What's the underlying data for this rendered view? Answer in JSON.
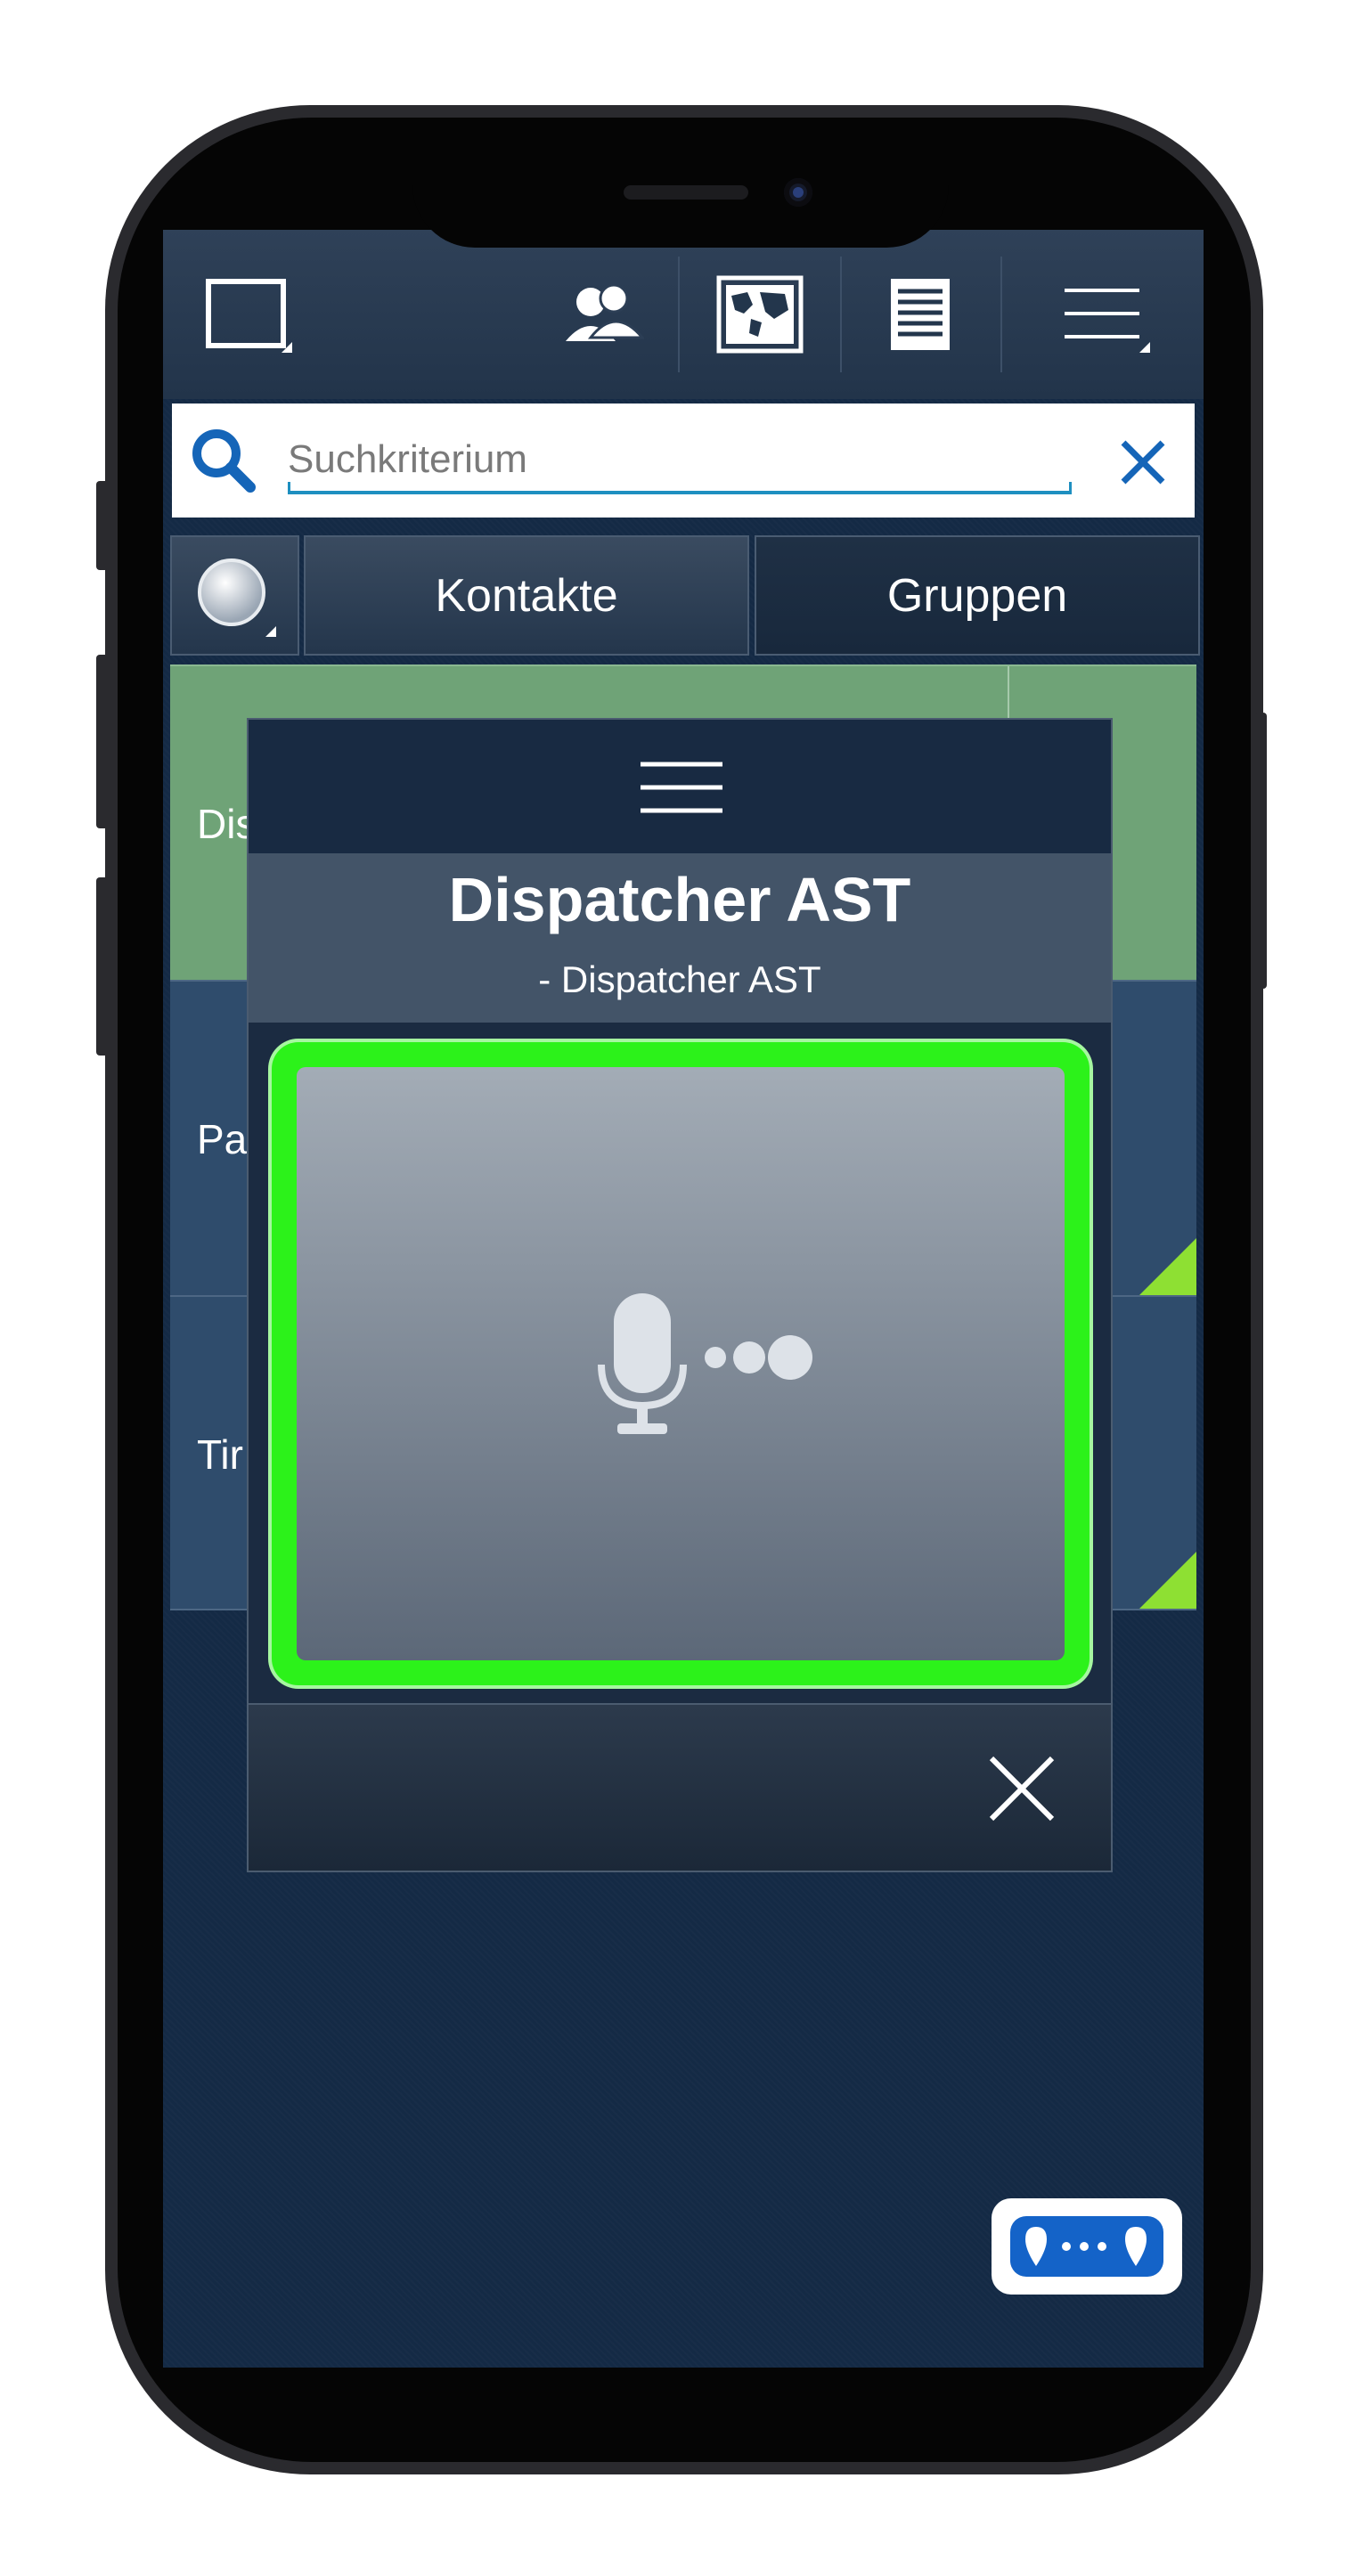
{
  "toolbar": {
    "buttons": [
      "window-button",
      "contacts-button",
      "map-button",
      "list-button",
      "menu-button"
    ]
  },
  "search": {
    "placeholder": "Suchkriterium",
    "value": ""
  },
  "tabs": {
    "status_icon": "status-circle-icon",
    "items": [
      {
        "label": "Kontakte",
        "active": false
      },
      {
        "label": "Gruppen",
        "active": true
      }
    ]
  },
  "list": {
    "rows": [
      {
        "label": "Dis",
        "color": "#6fa377"
      },
      {
        "label": "Pa",
        "color": "#2f4c6c"
      },
      {
        "label": "Tir",
        "color": "#2f4c6c"
      }
    ]
  },
  "dialog": {
    "title": "Dispatcher AST",
    "subtitle": "- Dispatcher AST",
    "ptt_state_color": "#2cf21a",
    "icons": [
      "hamburger-icon",
      "microphone-icon",
      "close-icon"
    ]
  },
  "floating": {
    "icon": "message-dots-icon",
    "color": "#1463c8"
  }
}
